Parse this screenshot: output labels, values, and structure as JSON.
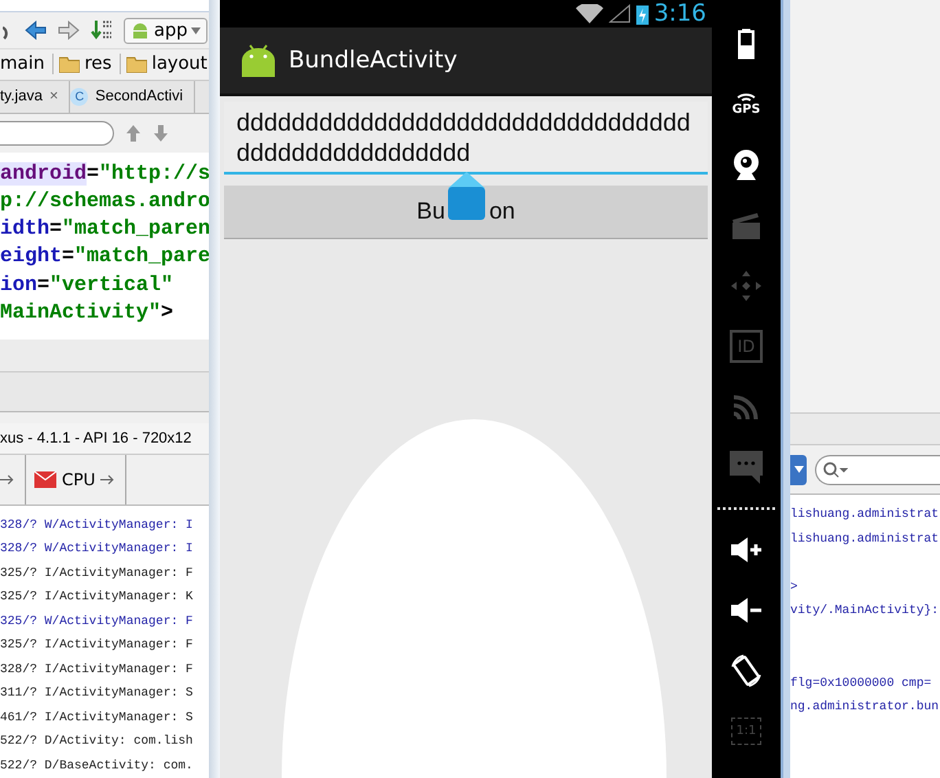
{
  "ide": {
    "run_config": "app",
    "breadcrumbs": [
      {
        "label": "main",
        "kind": "plain"
      },
      {
        "label": "res",
        "kind": "folder"
      },
      {
        "label": "layout",
        "kind": "folder"
      }
    ],
    "editor_tabs": [
      {
        "label": "ty.java",
        "close": "×"
      },
      {
        "label": "SecondActivi",
        "badge": "C"
      }
    ],
    "code_lines": [
      {
        "parts": [
          {
            "text": "android",
            "kind": "ns",
            "highlight": true
          },
          {
            "text": "=",
            "kind": "op",
            "highlight": false
          },
          {
            "text": "\"http://s",
            "kind": "value",
            "highlight": false
          }
        ]
      },
      {
        "parts": [
          {
            "text": "p://schemas.andro",
            "kind": "value",
            "highlight": false
          }
        ]
      },
      {
        "parts": [
          {
            "text": "idth",
            "kind": "attr",
            "highlight": false
          },
          {
            "text": "=",
            "kind": "op",
            "highlight": false
          },
          {
            "text": "\"match_paren",
            "kind": "value",
            "highlight": false
          }
        ]
      },
      {
        "parts": [
          {
            "text": "eight",
            "kind": "attr",
            "highlight": false
          },
          {
            "text": "=",
            "kind": "op",
            "highlight": false
          },
          {
            "text": "\"match_pare",
            "kind": "value",
            "highlight": false
          }
        ]
      },
      {
        "parts": [
          {
            "text": "ion",
            "kind": "attr",
            "highlight": false
          },
          {
            "text": "=",
            "kind": "op",
            "highlight": false
          },
          {
            "text": "\"vertical\"",
            "kind": "value",
            "highlight": false
          }
        ]
      },
      {
        "parts": [
          {
            "text": "MainActivity\"",
            "kind": "value",
            "highlight": false
          },
          {
            "text": ">",
            "kind": "op",
            "highlight": false
          }
        ]
      }
    ],
    "panel_title": "xus - 4.1.1 - API 16 - 720x12",
    "tool_tabs": [
      {
        "label": "CPU"
      }
    ],
    "log_lines": [
      {
        "text": "328/? W/ActivityManager:  I",
        "kind": "warn",
        "right_part": "lishuang.administrat"
      },
      {
        "text": "328/? W/ActivityManager:  I",
        "kind": "warn",
        "right_part": "lishuang.administrat"
      },
      {
        "text": "325/? I/ActivityManager:  F",
        "kind": "info"
      },
      {
        "text": "325/? I/ActivityManager:  K",
        "kind": "info",
        "right_part": ">"
      },
      {
        "text": "325/? W/ActivityManager:  F",
        "kind": "warn",
        "right_part": "vity/.MainActivity}:"
      },
      {
        "text": "325/? I/ActivityManager:  F",
        "kind": "info"
      },
      {
        "text": "328/? I/ActivityManager:  F",
        "kind": "info"
      },
      {
        "text": "311/? I/ActivityManager:  S",
        "kind": "info",
        "right_part": "flg=0x10000000 cmp="
      },
      {
        "text": "461/? I/ActivityManager:  S",
        "kind": "info",
        "right_part": "ng.administrator.bun"
      },
      {
        "text": "522/? D/Activity:  com.lish",
        "kind": "debug"
      },
      {
        "text": "522/? D/BaseActivity:  com.",
        "kind": "debug"
      }
    ]
  },
  "emulator": {
    "time": "3:16",
    "app_title": "BundleActivity",
    "edit_text": "dddddddddddddddddddddddddddddddddddddddddddddddddd",
    "button_parts": [
      "Bu",
      "on"
    ],
    "controls": [
      {
        "kind": "battery",
        "enabled": true
      },
      {
        "kind": "gps",
        "label": "GPS",
        "enabled": true
      },
      {
        "kind": "camera",
        "enabled": true
      },
      {
        "kind": "clapper",
        "enabled": false
      },
      {
        "kind": "dpad",
        "enabled": false
      },
      {
        "kind": "id",
        "label": "ID",
        "enabled": false
      },
      {
        "kind": "rss",
        "enabled": false
      },
      {
        "kind": "message",
        "enabled": false
      },
      {
        "kind": "divider",
        "enabled": true
      },
      {
        "kind": "volume-up",
        "enabled": true
      },
      {
        "kind": "volume-down",
        "enabled": true
      },
      {
        "kind": "rotate",
        "enabled": true
      },
      {
        "kind": "scale",
        "label": "1:1",
        "enabled": false
      }
    ]
  }
}
